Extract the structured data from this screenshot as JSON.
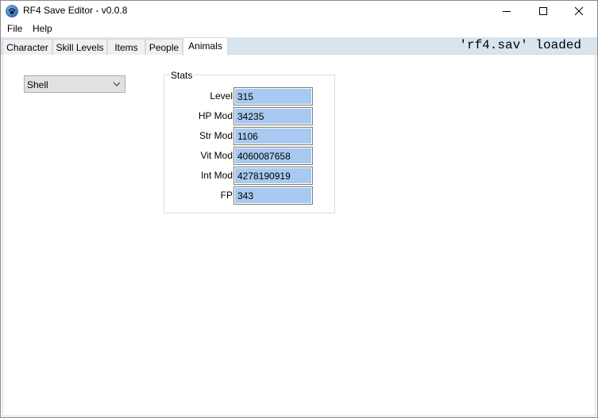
{
  "window": {
    "title": "RF4 Save Editor - v0.0.8",
    "icon": "paw-icon",
    "controls": [
      "minimize",
      "maximize",
      "close"
    ]
  },
  "menu": {
    "items": [
      {
        "label": "File"
      },
      {
        "label": "Help"
      }
    ]
  },
  "tabs": [
    {
      "label": "Character",
      "active": false
    },
    {
      "label": "Skill Levels",
      "active": false
    },
    {
      "label": "Items",
      "active": false
    },
    {
      "label": "People",
      "active": false
    },
    {
      "label": "Animals",
      "active": true
    }
  ],
  "status": "'rf4.sav' loaded",
  "animals": {
    "selected_animal": "Shell",
    "stats_group_title": "Stats",
    "fields": [
      {
        "label": "Level",
        "value": "315"
      },
      {
        "label": "HP Mod",
        "value": "34235"
      },
      {
        "label": "Str Mod",
        "value": "1106"
      },
      {
        "label": "Vit Mod",
        "value": "4060087658"
      },
      {
        "label": "Int Mod",
        "value": "4278190919"
      },
      {
        "label": "FP",
        "value": "343"
      }
    ]
  },
  "colors": {
    "tabstrip_bg": "#d9e4f1",
    "field_bg": "#a8c9f0"
  }
}
